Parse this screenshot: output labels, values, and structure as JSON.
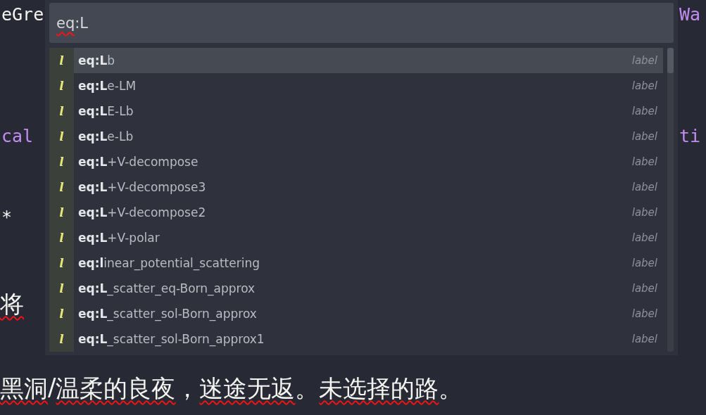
{
  "editor": {
    "lines": [
      {
        "left": [
          {
            "text": "eGre",
            "misspelled": false
          }
        ],
        "kind": "code",
        "right": "Wa"
      },
      {
        "left": [
          {
            "text": "cal",
            "misspelled": false
          }
        ],
        "kind": "keyword",
        "right": "ti"
      },
      {
        "left": [
          {
            "text": "*",
            "misspelled": false
          }
        ],
        "kind": "code"
      },
      {
        "left": [
          {
            "text": "将",
            "misspelled": true
          }
        ],
        "kind": "prose"
      },
      {
        "left": [
          {
            "text": "黑洞",
            "misspelled": true
          },
          {
            "text": "/",
            "misspelled": false
          },
          {
            "text": "温柔的良夜",
            "misspelled": true
          },
          {
            "text": "，",
            "misspelled": false
          },
          {
            "text": "迷途无返",
            "misspelled": true
          },
          {
            "text": "。",
            "misspelled": false
          },
          {
            "text": "未选择的路",
            "misspelled": true
          },
          {
            "text": "。",
            "misspelled": false
          }
        ],
        "kind": "prose"
      }
    ]
  },
  "autocomplete": {
    "query": [
      {
        "text": "eq",
        "misspelled": true
      },
      {
        "text": ":L",
        "misspelled": false
      }
    ],
    "items": [
      {
        "icon": "l",
        "match": "eq:L",
        "rest": "b",
        "type": "label",
        "selected": true
      },
      {
        "icon": "l",
        "match": "eq:L",
        "rest": "e-LM",
        "type": "label",
        "selected": false
      },
      {
        "icon": "l",
        "match": "eq:L",
        "rest": "E-Lb",
        "type": "label",
        "selected": false
      },
      {
        "icon": "l",
        "match": "eq:L",
        "rest": "e-Lb",
        "type": "label",
        "selected": false
      },
      {
        "icon": "l",
        "match": "eq:L",
        "rest": "+V-decompose",
        "type": "label",
        "selected": false
      },
      {
        "icon": "l",
        "match": "eq:L",
        "rest": "+V-decompose3",
        "type": "label",
        "selected": false
      },
      {
        "icon": "l",
        "match": "eq:L",
        "rest": "+V-decompose2",
        "type": "label",
        "selected": false
      },
      {
        "icon": "l",
        "match": "eq:L",
        "rest": "+V-polar",
        "type": "label",
        "selected": false
      },
      {
        "icon": "l",
        "match": "eq:l",
        "rest": "inear_potential_scattering",
        "type": "label",
        "selected": false
      },
      {
        "icon": "l",
        "match": "eq:L",
        "rest": "_scatter_eq-Born_approx",
        "type": "label",
        "selected": false
      },
      {
        "icon": "l",
        "match": "eq:L",
        "rest": "_scatter_sol-Born_approx",
        "type": "label",
        "selected": false
      },
      {
        "icon": "l",
        "match": "eq:L",
        "rest": "_scatter_sol-Born_approx1",
        "type": "label",
        "selected": false
      }
    ]
  }
}
